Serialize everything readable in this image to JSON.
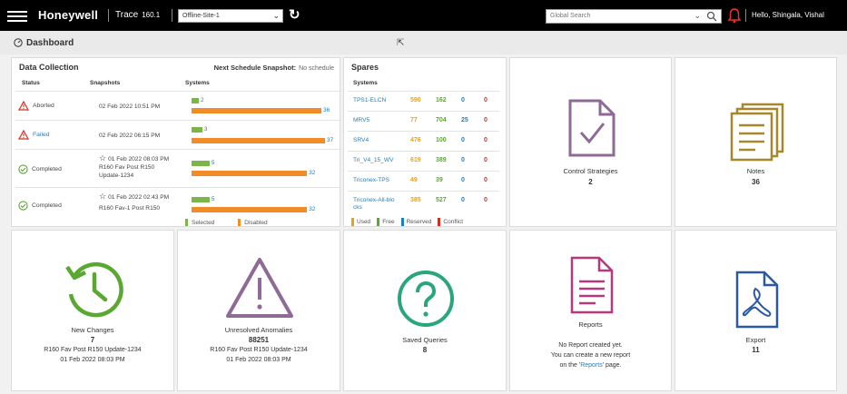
{
  "topbar": {
    "brand": "Honeywell",
    "product": "Trace",
    "version": "160.1",
    "site_value": "Offline-Site-1",
    "search_placeholder": "Global Search",
    "user_greeting": "Hello, Shingala, Vishal"
  },
  "page": {
    "title": "Dashboard"
  },
  "data_collection": {
    "title": "Data Collection",
    "next_label": "Next Schedule Snapshot:",
    "next_value": "No schedule",
    "columns": [
      "Status",
      "Snapshots",
      "Systems"
    ],
    "rows": [
      {
        "status": "Aborted",
        "status_color": "#d62d20",
        "snapshot_lines": [
          "02 Feb 2022 10:51 PM"
        ],
        "starred": false,
        "selected": 2,
        "disabled": 36
      },
      {
        "status": "Failed",
        "status_color": "#d62d20",
        "snapshot_lines": [
          "02 Feb 2022 06:15 PM"
        ],
        "starred": false,
        "selected": 3,
        "disabled": 37
      },
      {
        "status": "Completed",
        "status_color": "#5aa832",
        "snapshot_lines": [
          "01 Feb 2022 08:03 PM",
          "R160 Fav Post R150",
          "Update-1234"
        ],
        "starred": true,
        "selected": 5,
        "disabled": 32
      },
      {
        "status": "Completed",
        "status_color": "#5aa832",
        "snapshot_lines": [
          "01 Feb 2022 02:43 PM",
          "R160 Fav-1 Post R150"
        ],
        "starred": true,
        "selected": 5,
        "disabled": 32
      }
    ],
    "legend": {
      "selected": "Selected",
      "disabled": "Disabled"
    },
    "colors": {
      "selected": "#7ab648",
      "disabled": "#f28c28"
    }
  },
  "spares": {
    "title": "Spares",
    "column": "Systems",
    "rows": [
      {
        "name": "TPS1-ELCN",
        "used": "590",
        "free": "162",
        "reserved": "0",
        "conflict": "0"
      },
      {
        "name": "MRV5",
        "used": "77",
        "free": "704",
        "reserved": "25",
        "conflict": "0"
      },
      {
        "name": "SRV4",
        "used": "476",
        "free": "100",
        "reserved": "0",
        "conflict": "0"
      },
      {
        "name": "Tri_V4_15_WV",
        "used": "619",
        "free": "389",
        "reserved": "0",
        "conflict": "0"
      },
      {
        "name": "Triconex-TPS",
        "used": "49",
        "free": "39",
        "reserved": "0",
        "conflict": "0"
      },
      {
        "name": "Triconex-All-blo cks",
        "used": "385",
        "free": "527",
        "reserved": "0",
        "conflict": "0"
      }
    ],
    "legend": {
      "used": "Used",
      "free": "Free",
      "reserved": "Reserved",
      "conflict": "Conflict"
    },
    "colors": {
      "used": "#e8a21a",
      "free": "#5aa832",
      "reserved": "#1c7fc0",
      "conflict": "#d62d20"
    }
  },
  "tiles": {
    "control_strategies": {
      "label": "Control Strategies",
      "count": "2",
      "color": "#8e6a96"
    },
    "notes": {
      "label": "Notes",
      "count": "36",
      "color": "#a8862b"
    },
    "new_changes": {
      "label": "New Changes",
      "count": "7",
      "sub1": "R160 Fav Post R150 Update-1234",
      "sub2": "01 Feb 2022 08:03 PM",
      "color": "#5aa832"
    },
    "unresolved_anomalies": {
      "label": "Unresolved Anomalies",
      "count": "88251",
      "sub1": "R160 Fav Post R150 Update-1234",
      "sub2": "01 Feb 2022 08:03 PM",
      "color": "#8e6a96"
    },
    "saved_queries": {
      "label": "Saved Queries",
      "count": "8",
      "color": "#2aa67e"
    },
    "reports": {
      "label": "Reports",
      "sub1": "No Report created yet.",
      "sub2": "You can create a new report",
      "sub3_pre": "on the '",
      "sub3_link": "Reports",
      "sub3_post": "' page.",
      "color": "#b8387f"
    },
    "export": {
      "label": "Export",
      "count": "11",
      "color": "#2a5aa6"
    }
  }
}
